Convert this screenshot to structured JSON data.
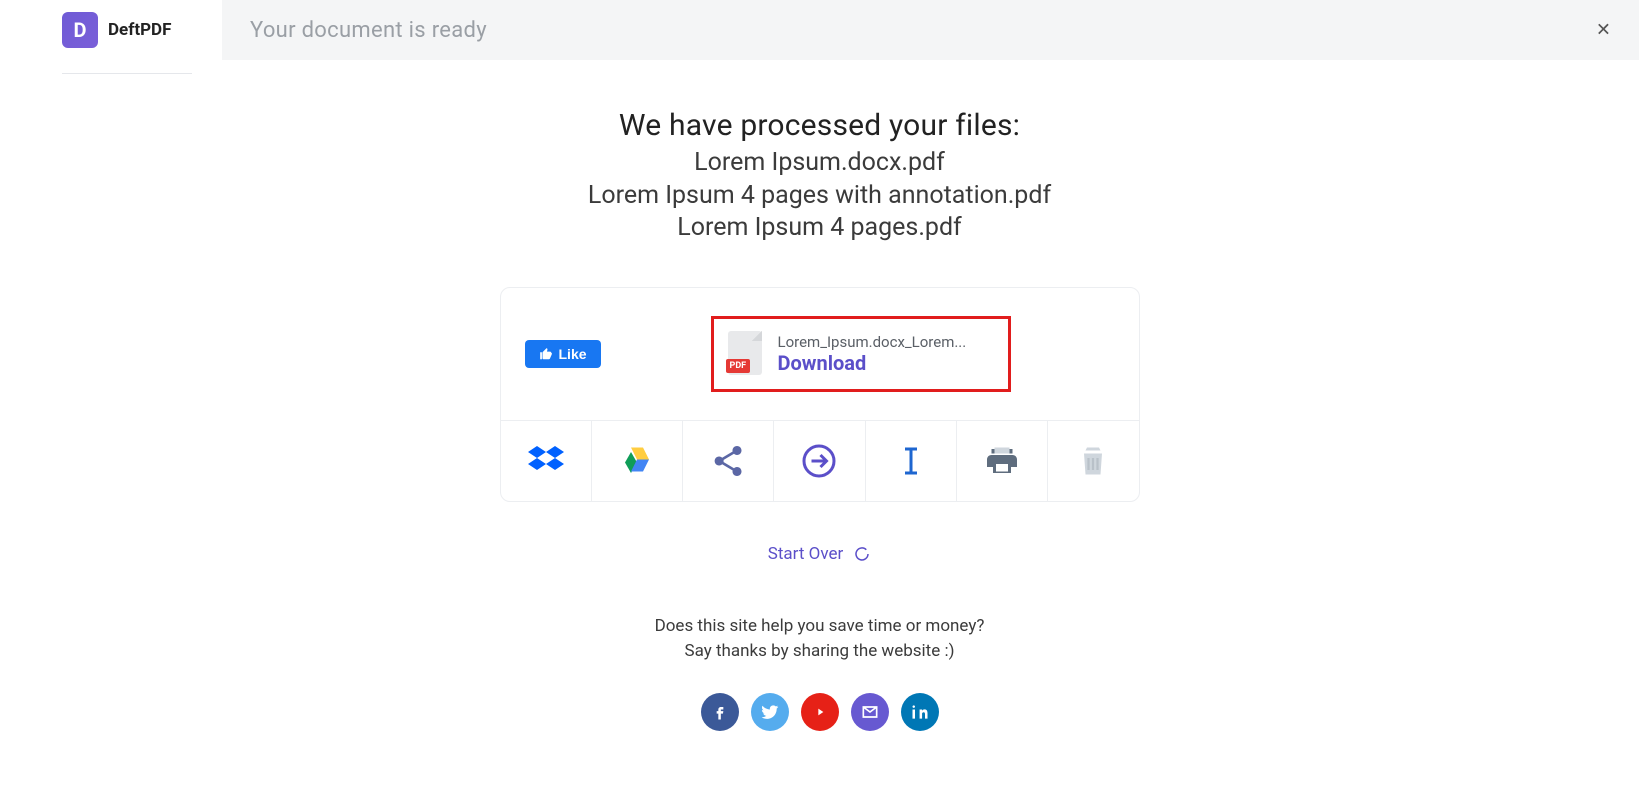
{
  "brand": {
    "logo_letter": "D",
    "name": "DeftPDF"
  },
  "header": {
    "title": "Your document is ready"
  },
  "processed": {
    "title": "We have processed your files:",
    "files": [
      "Lorem Ipsum.docx.pdf",
      "Lorem Ipsum 4 pages with annotation.pdf",
      "Lorem Ipsum 4 pages.pdf"
    ]
  },
  "like": {
    "label": "Like"
  },
  "download": {
    "filename": "Lorem_Ipsum.docx_Lorem...",
    "label": "Download",
    "badge": "PDF"
  },
  "actions": {
    "dropbox": "dropbox-icon",
    "gdrive": "google-drive-icon",
    "share": "share-icon",
    "arrow": "continue-arrow-icon",
    "rename": "rename-icon",
    "print": "print-icon",
    "delete": "trash-icon"
  },
  "start_over": {
    "label": "Start Over"
  },
  "thanks": {
    "line1": "Does this site help you save time or money?",
    "line2": "Say thanks by sharing the website :)"
  },
  "social": {
    "facebook": "facebook-icon",
    "twitter": "twitter-icon",
    "youtube": "youtube-icon",
    "email": "email-icon",
    "linkedin": "linkedin-icon"
  }
}
